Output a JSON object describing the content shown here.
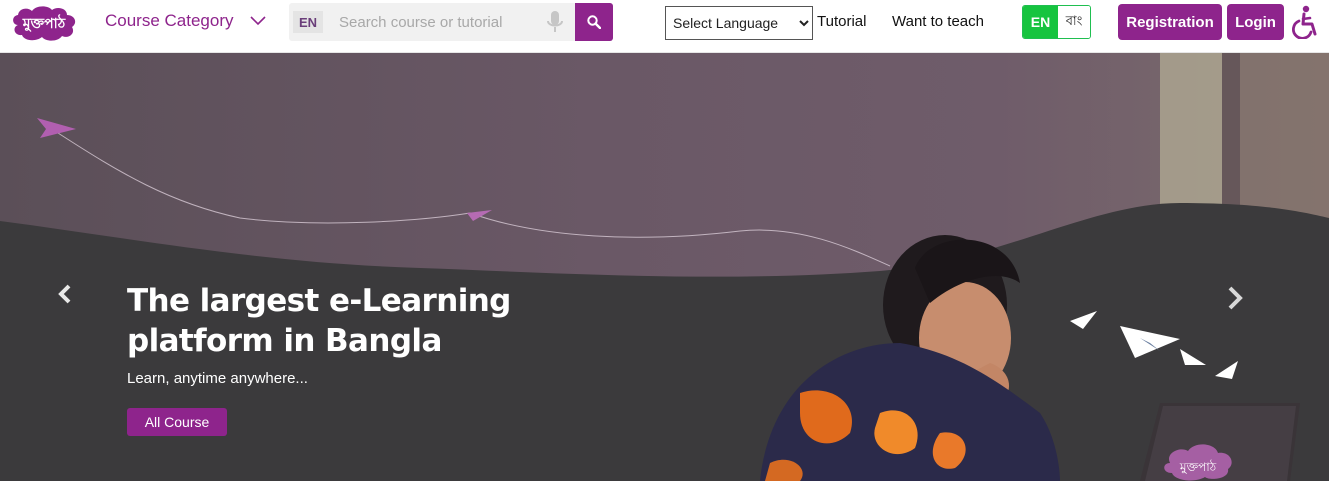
{
  "header": {
    "logo_text": "মুক্তপাঠ",
    "course_category_label": "Course Category",
    "search": {
      "lang_tag": "EN",
      "placeholder": "Search course or tutorial"
    },
    "select_language": {
      "selected": "Select Language"
    },
    "nav": {
      "tutorial": "Tutorial",
      "want_to_teach": "Want to teach"
    },
    "lang_toggle": {
      "en": "EN",
      "bn": "বাং"
    },
    "registration_label": "Registration",
    "login_label": "Login"
  },
  "hero": {
    "title": "The largest e-Learning platform in Bangla",
    "subtitle": "Learn, anytime anywhere...",
    "cta_label": "All Course",
    "laptop_logo_text": "মুক্তপাঠ"
  },
  "colors": {
    "brand_purple": "#8e248c",
    "toggle_green": "#16c43f"
  },
  "icons": {
    "search": "search-icon",
    "mic": "microphone-icon",
    "chevron": "chevron-down-icon",
    "accessibility": "wheelchair-icon",
    "prev": "chevron-left-icon",
    "next": "chevron-right-icon"
  }
}
